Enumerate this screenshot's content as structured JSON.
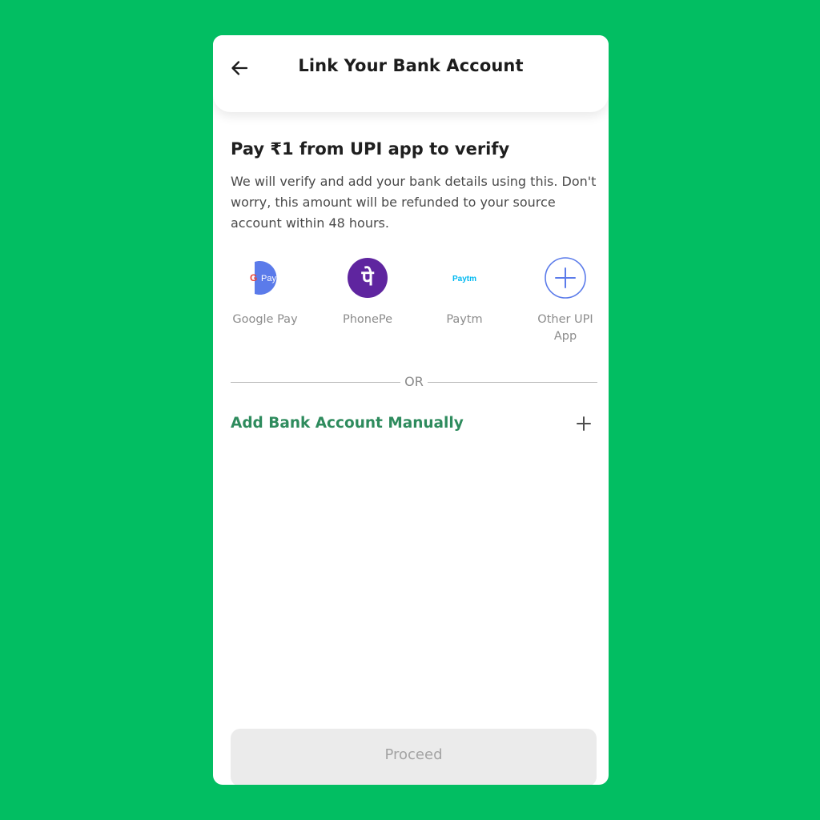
{
  "header": {
    "title": "Link Your Bank Account",
    "back_icon": "back-arrow-icon"
  },
  "verify": {
    "title": "Pay ₹1 from UPI app to verify",
    "description": "We will verify and add your bank details using this. Don't worry, this amount will be refunded to your source account within 48 hours."
  },
  "apps": [
    {
      "label": "Google Pay",
      "icon": "google-pay-icon",
      "icon_text": "Pay"
    },
    {
      "label": "PhonePe",
      "icon": "phonepe-icon",
      "icon_text": "पे"
    },
    {
      "label": "Paytm",
      "icon": "paytm-icon",
      "icon_text": "Paytm"
    },
    {
      "label": "Other UPI App",
      "icon": "plus-circle-icon"
    }
  ],
  "divider": {
    "text": "OR"
  },
  "manual": {
    "label": "Add Bank Account Manually",
    "icon": "plus-icon"
  },
  "proceed": {
    "label": "Proceed"
  },
  "colors": {
    "background": "#02BE62",
    "accent_green": "#2E8B5D",
    "phonepe_purple": "#5F259F",
    "gpay_blue": "#5B7BEA",
    "disabled_button": "#EBEBEB"
  }
}
